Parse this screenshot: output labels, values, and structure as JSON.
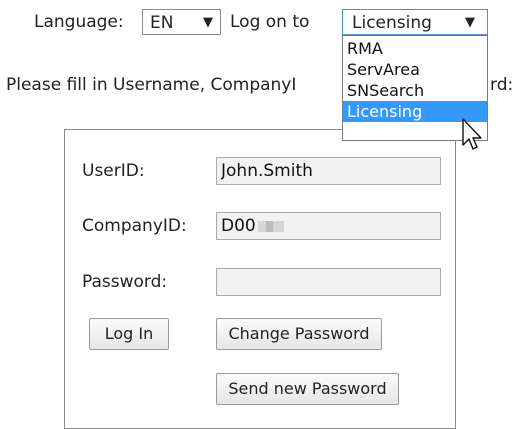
{
  "header": {
    "language_label": "Language:",
    "language_value": "EN",
    "logon_label": "Log on to",
    "logon_value": "Licensing"
  },
  "dropdown": {
    "options": [
      "RMA",
      "ServArea",
      "SNSearch",
      "Licensing"
    ],
    "selected": "Licensing",
    "highlight_color": "#3399ff"
  },
  "instruction": {
    "visible_left": "Please fill in Username, CompanyI",
    "visible_right": "rd:"
  },
  "form": {
    "userid_label": "UserID:",
    "userid_value": "John.Smith",
    "companyid_label": "CompanyID:",
    "companyid_value": "D00",
    "password_label": "Password:",
    "password_value": "",
    "login_button": "Log In",
    "change_password_button": "Change Password",
    "send_password_button": "Send new Password"
  },
  "icons": {
    "dropdown_arrow": "triangle-down-icon",
    "cursor": "mouse-pointer-icon"
  }
}
